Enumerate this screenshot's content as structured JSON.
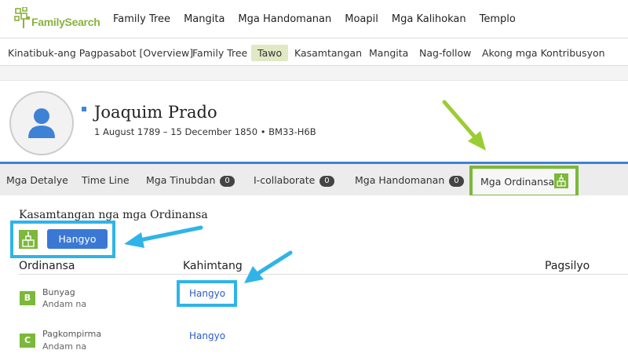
{
  "logo": {
    "text": "FamilySearch"
  },
  "topnav": [
    "Family Tree",
    "Mangita",
    "Mga Handomanan",
    "Moapil",
    "Mga Kalihokan",
    "Templo"
  ],
  "subnav": {
    "items": [
      "Kinatibuk-ang Pagpasabot [Overview]",
      "Family Tree",
      "Tawo",
      "Kasamtangan",
      "Mangita",
      "Nag-follow",
      "Akong mga Kontribusyon"
    ],
    "active": "Tawo"
  },
  "person": {
    "name": "Joaquim Prado",
    "lifespan": "1 August 1789 – 15 December 1850 • BM33-H6B"
  },
  "tabs": {
    "detalye": "Mga Detalye",
    "timeline": "Time Line",
    "tinubdan": "Mga Tinubdan",
    "tinubdan_count": "0",
    "collaborate": "I-collaborate",
    "collaborate_count": "0",
    "handomanan": "Mga Handomanan",
    "handomanan_count": "0",
    "ordinansa": "Mga Ordinansa"
  },
  "section": {
    "title": "Kasamtangan nga mga Ordinansa",
    "request_button": "Hangyo"
  },
  "columns": {
    "ordinance": "Ordinansa",
    "status": "Kahimtang",
    "place": "Pagsilyo"
  },
  "ordinances": [
    {
      "letter": "B",
      "name": "Bunyag",
      "sub": "Andam na",
      "status": "Hangyo"
    },
    {
      "letter": "C",
      "name": "Pagkompirma",
      "sub": "Andam na",
      "status": "Hangyo"
    }
  ],
  "colors": {
    "accent_green": "#7cb83a",
    "highlight_blue": "#2fb4e9",
    "button_blue": "#3a78d4",
    "link_blue": "#2a5dc8"
  },
  "icons": [
    "tree-logo-icon",
    "person-silhouette-icon",
    "temple-icon",
    "arrow-annotation"
  ]
}
